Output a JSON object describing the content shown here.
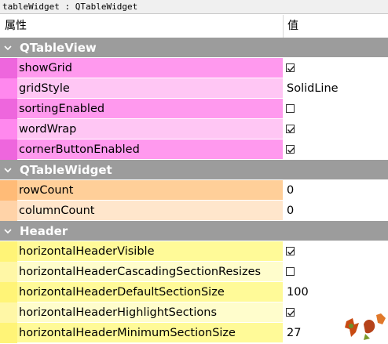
{
  "window_title": "tableWidget : QTableWidget",
  "header": {
    "name": "属性",
    "value": "值"
  },
  "groups": [
    {
      "label": "QTableView",
      "props": [
        {
          "name": "showGrid",
          "kind": "check",
          "checked": true
        },
        {
          "name": "gridStyle",
          "kind": "text",
          "value": "SolidLine"
        },
        {
          "name": "sortingEnabled",
          "kind": "check",
          "checked": false
        },
        {
          "name": "wordWrap",
          "kind": "check",
          "checked": true
        },
        {
          "name": "cornerButtonEnabled",
          "kind": "check",
          "checked": true
        }
      ]
    },
    {
      "label": "QTableWidget",
      "props": [
        {
          "name": "rowCount",
          "kind": "text",
          "value": "0"
        },
        {
          "name": "columnCount",
          "kind": "text",
          "value": "0"
        }
      ]
    },
    {
      "label": "Header",
      "props": [
        {
          "name": "horizontalHeaderVisible",
          "kind": "check",
          "checked": true
        },
        {
          "name": "horizontalHeaderCascadingSectionResizes",
          "kind": "check",
          "checked": false
        },
        {
          "name": "horizontalHeaderDefaultSectionSize",
          "kind": "text",
          "value": "100"
        },
        {
          "name": "horizontalHeaderHighlightSections",
          "kind": "check",
          "checked": true
        },
        {
          "name": "horizontalHeaderMinimumSectionSize",
          "kind": "text",
          "value": "27"
        }
      ]
    }
  ],
  "icons": {
    "group_toggle": "chevron-down-icon",
    "checkbox_mark": "checkmark-icon"
  },
  "colors": {
    "group_header": "#9c9c9c",
    "tableview_rows": [
      "#ff99ee",
      "#ffc6f4"
    ],
    "tablewidget_rows": [
      "#ffcf99",
      "#ffe6cc"
    ],
    "header_rows": [
      "#fffa98",
      "#fffdcc"
    ]
  }
}
